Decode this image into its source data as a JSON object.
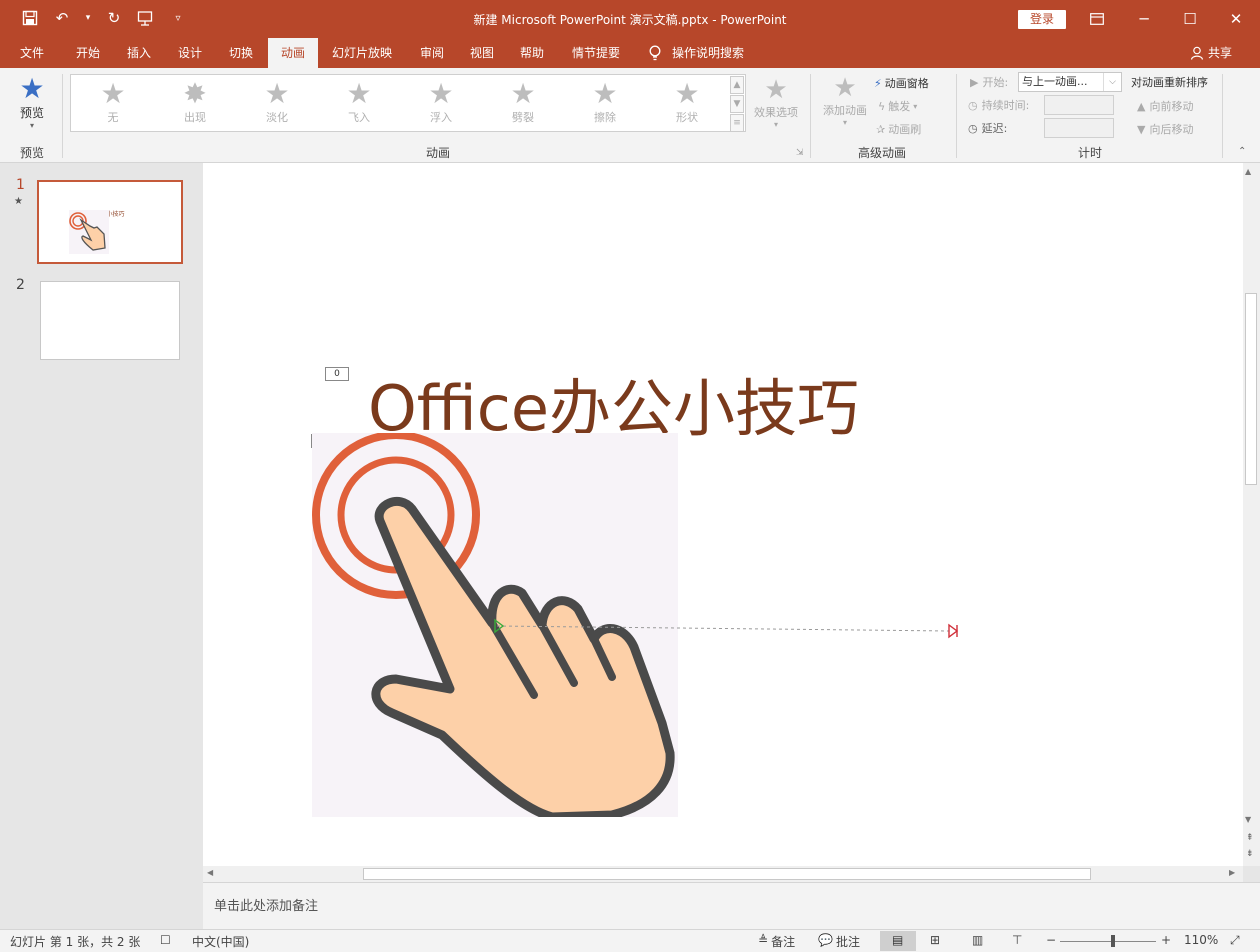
{
  "titlebar": {
    "title": "新建 Microsoft PowerPoint 演示文稿.pptx  -  PowerPoint",
    "signin_label": "登录",
    "bg_color": "#b7472a"
  },
  "tabs": [
    {
      "label": "文件"
    },
    {
      "label": "开始"
    },
    {
      "label": "插入"
    },
    {
      "label": "设计"
    },
    {
      "label": "切换"
    },
    {
      "label": "动画"
    },
    {
      "label": "幻灯片放映"
    },
    {
      "label": "审阅"
    },
    {
      "label": "视图"
    },
    {
      "label": "帮助"
    },
    {
      "label": "情节提要"
    }
  ],
  "active_tab": "动画",
  "search_label": "操作说明搜索",
  "share_label": "共享",
  "ribbon": {
    "preview_label": "预览",
    "preview_group": "预览",
    "animations": [
      {
        "label": "无"
      },
      {
        "label": "出现"
      },
      {
        "label": "淡化"
      },
      {
        "label": "飞入"
      },
      {
        "label": "浮入"
      },
      {
        "label": "劈裂"
      },
      {
        "label": "擦除"
      },
      {
        "label": "形状"
      }
    ],
    "effect_options": "效果选项",
    "animation_group": "动画",
    "add_animation": "添加动画",
    "animation_pane": "动画窗格",
    "trigger": "触发",
    "painter": "动画刷",
    "advanced_group": "高级动画",
    "start_label": "开始:",
    "start_value": "与上一动画...",
    "duration_label": "持续时间:",
    "delay_label": "延迟:",
    "timing_group": "计时",
    "reorder_title": "对动画重新排序",
    "move_earlier": "向前移动",
    "move_later": "向后移动"
  },
  "slides": [
    {
      "number": "1",
      "thumb_text": "Office办公小技巧"
    },
    {
      "number": "2"
    }
  ],
  "slide": {
    "title": "Office办公小技巧",
    "tag_title": "0",
    "tag_image": "0"
  },
  "notes_placeholder": "单击此处添加备注",
  "status": {
    "slide_info": "幻灯片 第 1 张，共 2 张",
    "language": "中文(中国)",
    "notes": "备注",
    "comments": "批注",
    "zoom": "110%",
    "zoom_level": 0.55
  }
}
